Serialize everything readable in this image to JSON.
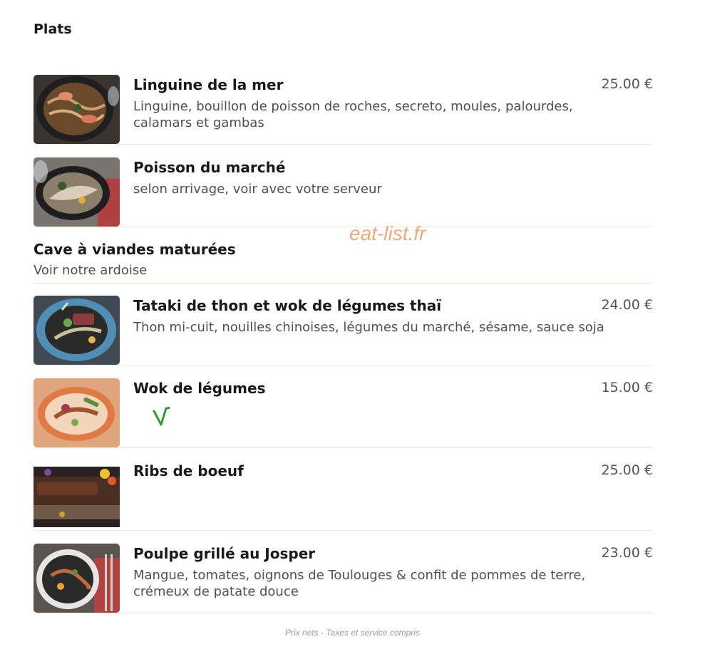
{
  "section": {
    "title": "Plats"
  },
  "watermark": "eat-list.fr",
  "items": [
    {
      "name": "Linguine de la mer",
      "description": "Linguine, bouillon de poisson de roches, secreto, moules, palourdes, calamars et gambas",
      "price": "25.00 €",
      "image": "linguine-photo"
    },
    {
      "name": "Poisson du marché",
      "description": "selon arrivage, voir avec votre serveur",
      "price": "",
      "image": "fish-photo"
    },
    {
      "name": "Tataki de thon et wok de légumes thaï",
      "description": "Thon mi-cuit, nouilles chinoises, légumes du marché, sésame, sauce soja",
      "price": "24.00 €",
      "image": "tataki-photo"
    },
    {
      "name": "Wok de légumes",
      "description": "",
      "price": "15.00 €",
      "image": "wok-photo",
      "badge": "vegetarian-icon"
    },
    {
      "name": "Ribs de boeuf",
      "description": "",
      "price": "25.00 €",
      "image": "ribs-photo"
    },
    {
      "name": "Poulpe grillé au Josper",
      "description": "Mangue, tomates, oignons de Toulouges & confit de pommes de terre, crémeux de patate douce",
      "price": "23.00 €",
      "image": "octopus-photo"
    }
  ],
  "info": {
    "title": "Cave à viandes maturées",
    "subtitle": "Voir notre ardoise"
  },
  "footer": "Prix nets - Taxes et service compris",
  "colors": {
    "divider": "#ececd4",
    "watermark": "#eba982",
    "vegetarian": "#2e9a2e"
  }
}
